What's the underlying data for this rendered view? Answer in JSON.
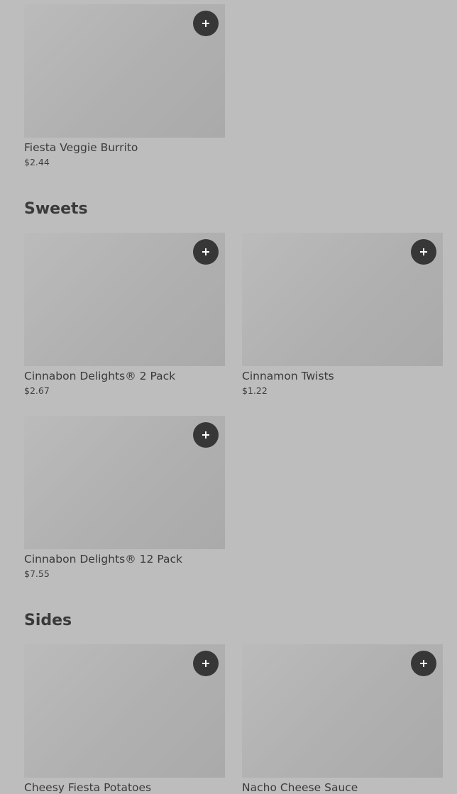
{
  "sections": [
    {
      "title": "",
      "items": [
        {
          "name": "Fiesta Veggie Burrito",
          "price": "$2.44",
          "add_icon": "plus-icon"
        }
      ]
    },
    {
      "title": "Sweets",
      "items": [
        {
          "name": "Cinnabon Delights® 2 Pack",
          "price": "$2.67",
          "add_icon": "plus-icon"
        },
        {
          "name": "Cinnamon Twists",
          "price": "$1.22",
          "add_icon": "plus-icon"
        },
        {
          "name": "Cinnabon Delights® 12 Pack",
          "price": "$7.55",
          "add_icon": "plus-icon"
        }
      ]
    },
    {
      "title": "Sides",
      "items": [
        {
          "name": "Cheesy Fiesta Potatoes",
          "price": "",
          "add_icon": "plus-icon"
        },
        {
          "name": "Nacho Cheese Sauce",
          "price": "",
          "add_icon": "plus-icon"
        }
      ]
    }
  ],
  "colors": {
    "background": "#bdbdbd",
    "button": "#373737",
    "text": "#3a3a3a"
  }
}
